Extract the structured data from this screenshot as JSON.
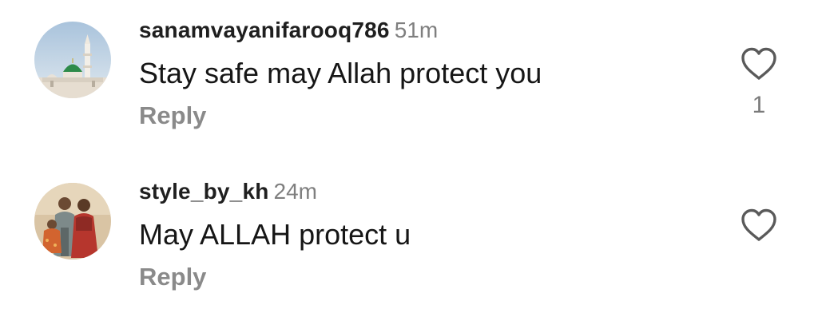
{
  "comments": [
    {
      "username": "sanamvayanifarooq786",
      "time": "51m",
      "text": "Stay safe may Allah protect you",
      "reply_label": "Reply",
      "like_icon": "heart-outline-icon",
      "like_count": "1",
      "avatar": "mosque-avatar"
    },
    {
      "username": "style_by_kh",
      "time": "24m",
      "text": "May ALLAH protect u",
      "reply_label": "Reply",
      "like_icon": "heart-outline-icon",
      "like_count": "",
      "avatar": "family-portrait-avatar"
    }
  ],
  "colors": {
    "username": "#1f1f1f",
    "timestamp": "#7f7f7f",
    "reply": "#8a8a8a",
    "icon": "#5a5a5a"
  }
}
